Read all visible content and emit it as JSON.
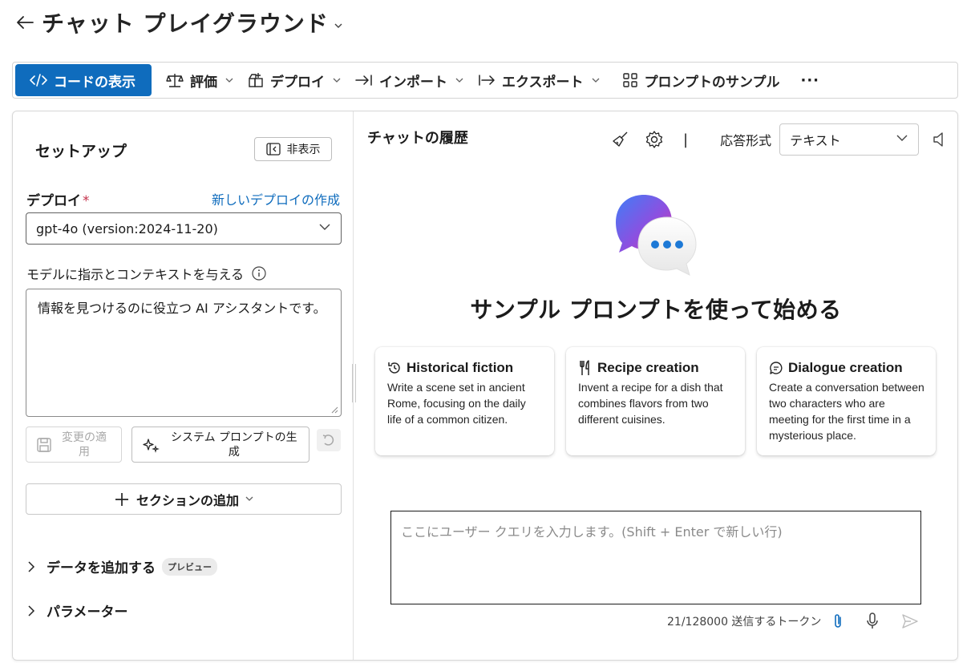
{
  "header": {
    "title": "チャット プレイグラウンド"
  },
  "toolbar": {
    "view_code": "コードの表示",
    "evaluate": "評価",
    "deploy": "デプロイ",
    "import": "インポート",
    "export": "エクスポート",
    "sample_prompts": "プロンプトのサンプル",
    "more": "···"
  },
  "setup": {
    "title": "セットアップ",
    "hide": "非表示",
    "deploy_label": "デプロイ",
    "required": "*",
    "create_link": "新しいデプロイの作成",
    "model_value": "gpt-4o (version:2024-11-20)",
    "instructions_label": "モデルに指示とコンテキストを与える",
    "system_message": "情報を見つけるのに役立つ AI アシスタントです。",
    "apply_line1": "変更の適",
    "apply_line2": "用",
    "generate_line1": "システム プロンプトの生",
    "generate_line2": "成",
    "add_section": "セクションの追加",
    "add_data": "データを追加する",
    "preview_badge": "プレビュー",
    "parameters": "パラメーター"
  },
  "chat": {
    "history_title": "チャットの履歴",
    "separator": "|",
    "response_format_label": "応答形式",
    "response_format_value": "テキスト",
    "hero_title": "サンプル プロンプトを使って始める",
    "cards": [
      {
        "title": "Historical fiction",
        "desc": "Write a scene set in ancient Rome, focusing on the daily life of a common citizen.",
        "icon": "history-icon"
      },
      {
        "title": "Recipe creation",
        "desc": "Invent a recipe for a dish that combines flavors from two different cuisines.",
        "icon": "food-icon"
      },
      {
        "title": "Dialogue creation",
        "desc": "Create a conversation between two characters who are meeting for the first time in a mysterious place.",
        "icon": "chat-bubble-icon"
      }
    ],
    "query_placeholder": "ここにユーザー クエリを入力します。(Shift + Enter で新しい行)",
    "token_count": "21/128000 送信するトークン"
  },
  "colors": {
    "accent": "#0f6cbd",
    "required": "#c4314b"
  }
}
